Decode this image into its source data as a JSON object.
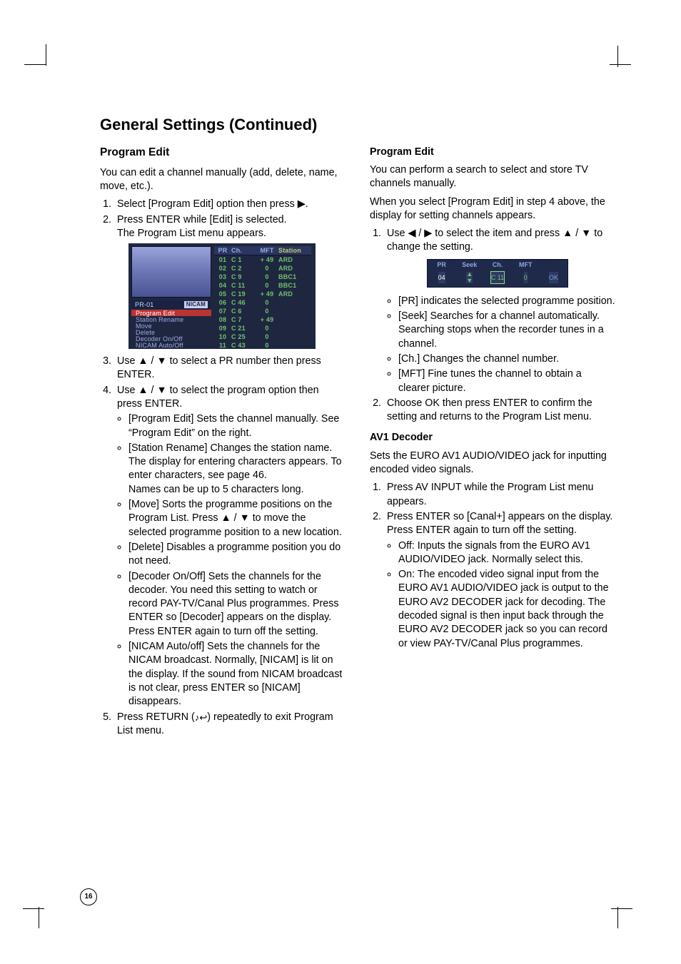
{
  "page_number": "16",
  "title": "General Settings (Continued)",
  "left": {
    "h2": "Program Edit",
    "intro": "You can edit a channel manually (add, delete, name, move, etc.).",
    "step1": "Select [Program Edit] option then press ▶.",
    "step2a": "Press ENTER while [Edit] is selected.",
    "step2b": "The Program List menu appears.",
    "step3": "Use ▲ / ▼ to select a PR number then press ENTER.",
    "step4": "Use ▲ / ▼ to select the program option then press ENTER.",
    "b1": "[Program Edit] Sets the channel manually. See “Program Edit” on the right.",
    "b2": "[Station Rename] Changes the station name. The display for entering characters appears. To enter characters, see page 46.",
    "b2b": "Names can be up to 5 characters long.",
    "b3": "[Move] Sorts the programme positions on the Program List. Press ▲ / ▼ to move the selected programme position to a new location.",
    "b4": "[Delete] Disables a programme position you do not need.",
    "b5": "[Decoder On/Off] Sets the channels for the decoder. You need this setting to watch or record PAY-TV/Canal Plus programmes. Press ENTER so [Decoder] appears on the display. Press ENTER again to turn off the setting.",
    "b6": "[NICAM Auto/off] Sets the channels for the NICAM broadcast. Normally, [NICAM] is lit on the display. If the sound from NICAM broadcast is not clear, press ENTER so [NICAM] disappears.",
    "step5a": "Press RETURN (",
    "step5b": ") repeatedly to exit Program List menu."
  },
  "fig1": {
    "preview_text": "",
    "pr_label": "PR-01",
    "nicam": "NICAM",
    "menu": [
      "Program Edit",
      "Station Rename",
      "Move",
      "Delete",
      "Decoder On/Off",
      "NICAM Auto/Off"
    ],
    "head": {
      "pr": "PR",
      "ch": "Ch.",
      "mft": "MFT",
      "st": "Station"
    },
    "rows": [
      {
        "pr": "01",
        "ch": "C 1",
        "mft": "+ 49",
        "st": "ARD"
      },
      {
        "pr": "02",
        "ch": "C 2",
        "mft": "0",
        "st": "ARD"
      },
      {
        "pr": "03",
        "ch": "C 9",
        "mft": "0",
        "st": "BBC1"
      },
      {
        "pr": "04",
        "ch": "C 11",
        "mft": "0",
        "st": "BBC1"
      },
      {
        "pr": "05",
        "ch": "C 19",
        "mft": "+ 49",
        "st": "ARD"
      },
      {
        "pr": "06",
        "ch": "C 46",
        "mft": "0",
        "st": ""
      },
      {
        "pr": "07",
        "ch": "C 6",
        "mft": "0",
        "st": ""
      },
      {
        "pr": "08",
        "ch": "C 7",
        "mft": "+ 49",
        "st": ""
      },
      {
        "pr": "09",
        "ch": "C 21",
        "mft": "0",
        "st": ""
      },
      {
        "pr": "10",
        "ch": "C 25",
        "mft": "0",
        "st": ""
      },
      {
        "pr": "11",
        "ch": "C 43",
        "mft": "0",
        "st": ""
      }
    ]
  },
  "right": {
    "h_pe": "Program Edit",
    "pe1": "You can perform a search to select and store TV channels manually.",
    "pe2": "When you select [Program Edit] in step 4 above, the display for setting channels appears.",
    "pe_s1": "Use ◀ / ▶ to select the item and press ▲ / ▼ to change the setting.",
    "pe_b1": "[PR] indicates the selected programme position.",
    "pe_b2": "[Seek] Searches for a channel automatically. Searching stops when the recorder tunes in a channel.",
    "pe_b3": "[Ch.] Changes the channel number.",
    "pe_b4": "[MFT] Fine tunes the channel to obtain a clearer picture.",
    "pe_s2": "Choose OK then press ENTER to confirm the setting and returns to the Program List menu.",
    "h_av": "AV1 Decoder",
    "av1": "Sets the EURO AV1 AUDIO/VIDEO jack for inputting encoded video signals.",
    "av_s1": "Press AV INPUT while the Program List menu appears.",
    "av_s2": "Press ENTER so [Canal+] appears on the display. Press ENTER again to turn off the setting.",
    "av_b1": "Off: Inputs the signals from the EURO AV1 AUDIO/VIDEO jack. Normally select this.",
    "av_b2": "On: The encoded video signal input from the EURO AV1 AUDIO/VIDEO jack is output to the EURO AV2 DECODER jack for decoding. The decoded signal is then input back through the EURO AV2 DECODER jack so you can record or view PAY-TV/Canal Plus programmes."
  },
  "fig2": {
    "head": {
      "pr": "PR",
      "seek": "Seek",
      "ch": "Ch.",
      "mft": "MFT",
      "ok": ""
    },
    "row": {
      "pr": "04",
      "seek_up": "▲",
      "seek_dn": "▼",
      "ch": "C 11",
      "mft": "0",
      "ok": "OK"
    }
  }
}
